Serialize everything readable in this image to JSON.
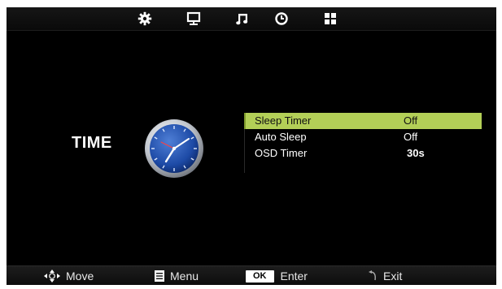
{
  "top_tabs": [
    {
      "icon": "gear-icon",
      "active": true
    },
    {
      "icon": "monitor-icon",
      "active": false
    },
    {
      "icon": "music-note-icon",
      "active": false
    },
    {
      "icon": "clock-icon",
      "active": false
    },
    {
      "icon": "grid-icon",
      "active": false
    }
  ],
  "section": {
    "title": "TIME",
    "icon": "analog-clock-icon"
  },
  "menu": {
    "items": [
      {
        "label": "Sleep Timer",
        "value": "Off",
        "selected": true
      },
      {
        "label": "Auto Sleep",
        "value": "Off",
        "selected": false
      },
      {
        "label": "OSD Timer",
        "value": "30s",
        "selected": false
      }
    ]
  },
  "hints": {
    "move": "Move",
    "menu": "Menu",
    "ok_key": "OK",
    "enter": "Enter",
    "exit": "Exit"
  },
  "colors": {
    "background": "#000000",
    "highlight": "#b3cf57",
    "text": "#ffffff"
  }
}
